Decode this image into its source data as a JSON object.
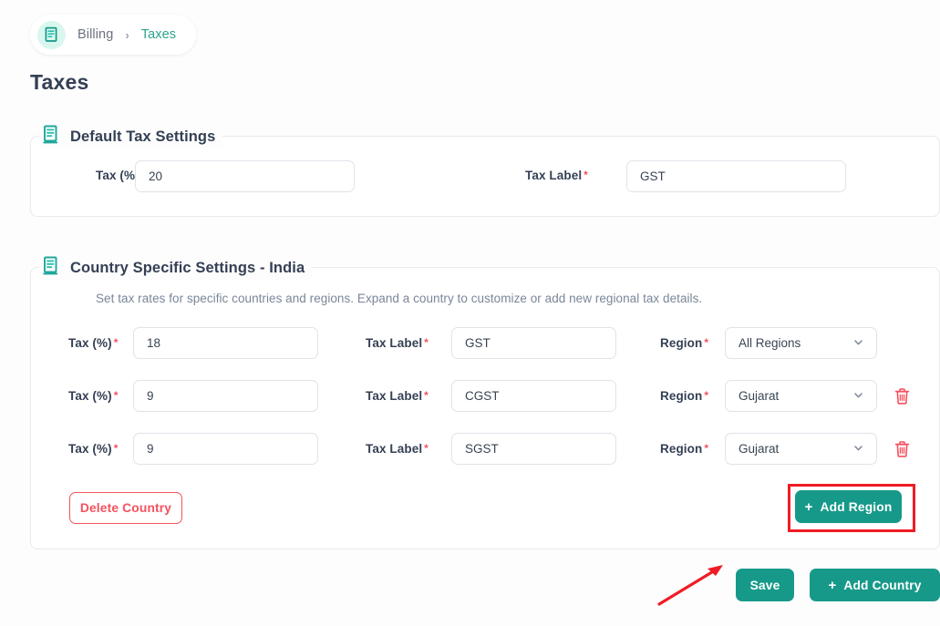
{
  "breadcrumb": {
    "icon": "document-icon",
    "parent": "Billing",
    "separator": "›",
    "current": "Taxes"
  },
  "page_title": "Taxes",
  "default_section": {
    "legend": "Default Tax Settings",
    "icon": "document-list-icon",
    "fields": {
      "tax_percent_label": "Tax (%)",
      "tax_percent_value": "20",
      "tax_label_label": "Tax Label",
      "tax_label_value": "GST",
      "required_marker": "*"
    }
  },
  "country_section": {
    "legend": "Country Specific Settings - India",
    "icon": "document-list-icon",
    "description": "Set tax rates for specific countries and regions. Expand a country to customize or add new regional tax details.",
    "labels": {
      "tax_percent": "Tax (%)",
      "tax_label": "Tax Label",
      "region": "Region",
      "required_marker": "*"
    },
    "rows": [
      {
        "tax_percent": "18",
        "tax_label": "GST",
        "region": "All Regions",
        "deletable": false
      },
      {
        "tax_percent": "9",
        "tax_label": "CGST",
        "region": "Gujarat",
        "deletable": true
      },
      {
        "tax_percent": "9",
        "tax_label": "SGST",
        "region": "Gujarat",
        "deletable": true
      }
    ],
    "delete_country_label": "Delete Country",
    "add_region_label": "Add Region",
    "add_icon": "plus-icon",
    "delete_icon": "trash-icon",
    "dropdown_icon": "chevron-down-icon"
  },
  "footer": {
    "save_label": "Save",
    "add_country_label": "Add Country",
    "add_icon": "plus-icon"
  },
  "annotations": {
    "highlight_target": "Add Region",
    "arrow_target": "Save",
    "color": "#EE1C25"
  },
  "colors": {
    "accent_teal": "#17998A",
    "breadcrumb_teal": "#2BA58B",
    "danger_red": "#F4525F",
    "annotation_red": "#EE1C25",
    "page_bg": "#FDFDFD",
    "card_bg": "#FFFFFF",
    "border": "#E7EAEE",
    "text_dark": "#344054",
    "text_muted": "#7A8699"
  }
}
